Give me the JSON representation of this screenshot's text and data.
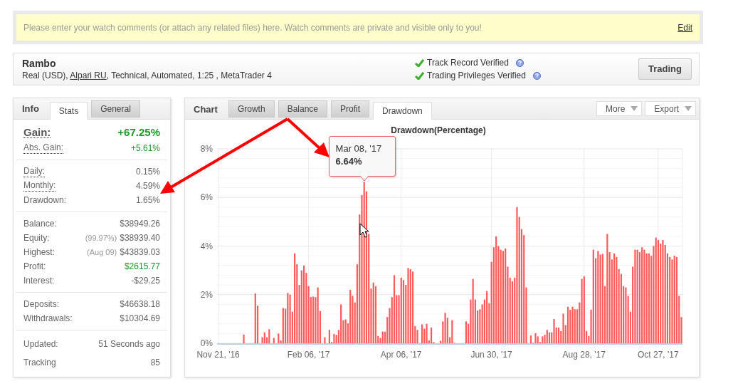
{
  "comment_bar": {
    "text": "Please enter your watch comments (or attach any related files) here. Watch comments are private and visible only to you!",
    "link": "Edit"
  },
  "account": {
    "name": "Rambo",
    "details_before": "Real (USD), ",
    "broker": "Alpari RU",
    "details_after": ", Technical, Automated, 1:25 , MetaTrader 4",
    "verifications": [
      "Track Record Verified",
      "Trading Privileges Verified"
    ],
    "button": "Trading"
  },
  "info_panel": {
    "title": "Info",
    "tabs": [
      {
        "label": "Stats",
        "selected": true
      },
      {
        "label": "General",
        "selected": false
      }
    ],
    "groups": [
      [
        {
          "label": "Gain:",
          "value": "+67.25%",
          "kind": "headline",
          "dotted": true,
          "color": "#1a9a28"
        },
        {
          "label": "Abs. Gain:",
          "value": "+5.61%",
          "kind": "row",
          "dotted": true,
          "color": "#1a9a28"
        }
      ],
      [
        {
          "label": "Daily:",
          "value": "0.15%",
          "kind": "row",
          "dotted": true,
          "color": "#666666"
        },
        {
          "label": "Monthly:",
          "value": "4.59%",
          "kind": "row",
          "dotted": true,
          "color": "#666666"
        },
        {
          "label": "Drawdown:",
          "value": "1.65%",
          "kind": "row",
          "dotted": false,
          "color": "#666666"
        }
      ],
      [
        {
          "label": "Balance:",
          "value": "$38949.26",
          "kind": "row",
          "dotted": false,
          "color": "#666666"
        },
        {
          "label": "Equity:",
          "note": "(99.97%)",
          "value": "$38939.40",
          "kind": "row",
          "dotted": false,
          "color": "#666666"
        },
        {
          "label": "Highest:",
          "note": "(Aug 09)",
          "value": "$43839.03",
          "kind": "row",
          "dotted": false,
          "color": "#666666"
        },
        {
          "label": "Profit:",
          "value": "$2615.77",
          "kind": "row",
          "dotted": false,
          "color": "#1a9a28"
        },
        {
          "label": "Interest:",
          "value": "-$29.25",
          "kind": "row",
          "dotted": false,
          "color": "#666666"
        }
      ],
      [
        {
          "label": "Deposits:",
          "value": "$46638.18",
          "kind": "row",
          "dotted": false,
          "color": "#666666"
        },
        {
          "label": "Withdrawals:",
          "value": "$10304.69",
          "kind": "row",
          "dotted": false,
          "color": "#666666"
        }
      ],
      [
        {
          "label": "Updated:",
          "value": "51 Seconds ago",
          "kind": "tall",
          "dotted": false,
          "color": "#666666"
        },
        {
          "label": "Tracking",
          "value": "85",
          "kind": "tall",
          "dotted": false,
          "color": "#666666"
        }
      ]
    ]
  },
  "chart_panel": {
    "title": "Chart",
    "tabs": [
      {
        "label": "Growth",
        "selected": false
      },
      {
        "label": "Balance",
        "selected": false
      },
      {
        "label": "Profit",
        "selected": false
      },
      {
        "label": "Drawdown",
        "selected": true
      }
    ],
    "menus": [
      "More",
      "Export"
    ],
    "tooltip": {
      "date": "Mar 08, '17",
      "value": "6.64%"
    },
    "chart_data": {
      "type": "bar",
      "title": "Drawdown(Percentage)",
      "categories": [
        "Nov 21, '16",
        null,
        null,
        null,
        null,
        null,
        null,
        null,
        null,
        null,
        null,
        null,
        null,
        null,
        null,
        null,
        null,
        null,
        null,
        null,
        null,
        null,
        null,
        null,
        null,
        null,
        null,
        null,
        null,
        null,
        null,
        null,
        null,
        null,
        null,
        null,
        null,
        null,
        null,
        "Feb 06, '17",
        null,
        null,
        null,
        null,
        null,
        null,
        null,
        null,
        null,
        null,
        null,
        null,
        null,
        null,
        null,
        null,
        null,
        null,
        null,
        null,
        null,
        null,
        null,
        null,
        null,
        null,
        null,
        null,
        null,
        null,
        null,
        null,
        null,
        null,
        null,
        null,
        null,
        null,
        null,
        "Apr 06, '17",
        null,
        null,
        null,
        null,
        null,
        null,
        null,
        null,
        null,
        null,
        null,
        null,
        null,
        null,
        null,
        null,
        null,
        null,
        null,
        null,
        null,
        null,
        null,
        null,
        null,
        null,
        null,
        null,
        null,
        null,
        null,
        null,
        null,
        null,
        null,
        null,
        null,
        null,
        "Jun 30, '17",
        null,
        null,
        null,
        null,
        null,
        null,
        null,
        null,
        null,
        null,
        null,
        null,
        null,
        null,
        null,
        null,
        null,
        null,
        null,
        null,
        null,
        null,
        null,
        null,
        null,
        null,
        null,
        null,
        null,
        null,
        null,
        null,
        null,
        null,
        null,
        null,
        null,
        null,
        null,
        "Aug 28, '17",
        null,
        null,
        null,
        null,
        null,
        null,
        null,
        null,
        null,
        null,
        null,
        null,
        null,
        null,
        null,
        null,
        null,
        null,
        null,
        null,
        null,
        null,
        null,
        null,
        null,
        null,
        null,
        null,
        null,
        null,
        null,
        "Oct 27, '17",
        null,
        null,
        null,
        null,
        null,
        null,
        null,
        null,
        null,
        null
      ],
      "series": [
        {
          "color": "#ff5a5a",
          "values": [
            0,
            0,
            0,
            0,
            0,
            0,
            0,
            0,
            0,
            0,
            0,
            0.36,
            0,
            0,
            0,
            0,
            2.05,
            1.55,
            0,
            0.25,
            0.45,
            0.25,
            0.58,
            0,
            0.22,
            0,
            0.4,
            0.12,
            1.45,
            1.42,
            2.07,
            2.0,
            1.3,
            3.7,
            3.25,
            2.4,
            3.0,
            3.2,
            2.9,
            2.35,
            1.9,
            1.92,
            1.9,
            2.3,
            1.32,
            0,
            0.25,
            0,
            0.55,
            0.05,
            0.38,
            0.35,
            0.55,
            1.6,
            0.95,
            0.98,
            0.82,
            2.2,
            1.95,
            1.68,
            3.25,
            5.3,
            6.1,
            6.64,
            6.25,
            4.5,
            2.25,
            2.5,
            2.35,
            0.3,
            0.22,
            0.48,
            0.48,
            1.08,
            1.45,
            1.9,
            2.8,
            1.98,
            1.98,
            2.7,
            2.6,
            2.4,
            3.1,
            3.05,
            2.95,
            0.7,
            0.55,
            0,
            0.78,
            0.6,
            0.8,
            0.12,
            0.65,
            0.05,
            0,
            0,
            0.1,
            0.9,
            1.25,
            1.05,
            0.25,
            0.95,
            0.02,
            0,
            0,
            0,
            0,
            0.9,
            0.8,
            1.8,
            2.65,
            1.8,
            1.35,
            1.4,
            1.6,
            1.8,
            2.15,
            1.65,
            3.35,
            3.95,
            4.4,
            4.0,
            3.85,
            3.8,
            3.9,
            3.15,
            2.7,
            2.55,
            2.7,
            5.6,
            5.2,
            4.7,
            4.45,
            2.3,
            0,
            0.32,
            0.02,
            0.42,
            0.28,
            0.05,
            0.28,
            0.35,
            0.55,
            0.45,
            0.45,
            1.0,
            0.65,
            0.65,
            0.5,
            1.22,
            0.75,
            1.5,
            1.38,
            1.5,
            1.4,
            1.4,
            1.68,
            2.65,
            2.75,
            0.5,
            0.3,
            1.38,
            3.85,
            3.5,
            3.8,
            3.65,
            3.68,
            2.35,
            4.5,
            3.75,
            3.45,
            3.7,
            3.55,
            3.05,
            2.85,
            2.35,
            2.3,
            1.95,
            1.3,
            3.15,
            3.85,
            3.85,
            3.75,
            3.95,
            3.85,
            3.7,
            3.7,
            3.6,
            4.0,
            4.35,
            4.25,
            4.1,
            4.25,
            4.05,
            3.7,
            3.55,
            3.45,
            3.6,
            3.55,
            1.95,
            1.08
          ]
        }
      ],
      "ylim": [
        0,
        8
      ],
      "grid": true,
      "yticks": [
        {
          "value": 0,
          "label": "0%"
        },
        {
          "value": 2,
          "label": "2%"
        },
        {
          "value": 4,
          "label": "4%"
        },
        {
          "value": 6,
          "label": "6%"
        },
        {
          "value": 8,
          "label": "8%"
        }
      ]
    }
  }
}
